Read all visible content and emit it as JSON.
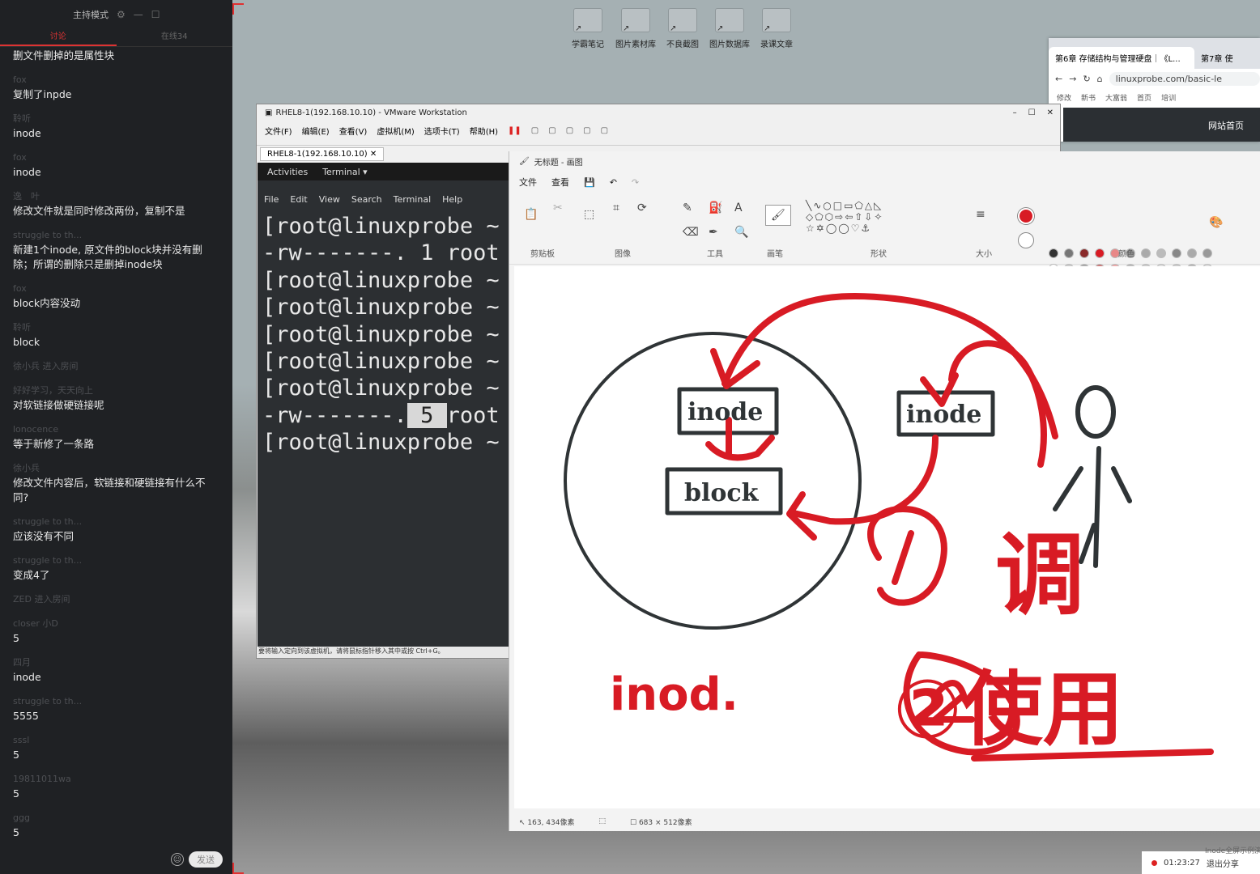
{
  "chat": {
    "mode_label": "主持模式",
    "tabs": [
      "讨论",
      "在线34"
    ],
    "messages": [
      {
        "user": "",
        "text": "删文件删掉的是属性块"
      },
      {
        "user": "fox",
        "text": "复制了inpde"
      },
      {
        "user": "聆听",
        "text": "inode"
      },
      {
        "user": "fox",
        "text": "inode"
      },
      {
        "user": "逸　叶",
        "text": "修改文件就是同时修改两份，复制不是"
      },
      {
        "user": "struggle to th...",
        "text": "新建1个inode, 原文件的block块并没有删除；所谓的删除只是删掉inode块"
      },
      {
        "user": "fox",
        "text": "block内容没动"
      },
      {
        "user": "聆听",
        "text": "block"
      },
      {
        "user": "徐小兵 进入房间",
        "text": ""
      },
      {
        "user": "好好学习，天天向上",
        "text": "对软链接做硬链接呢"
      },
      {
        "user": "lonocence",
        "text": "等于新修了一条路"
      },
      {
        "user": "徐小兵",
        "text": "修改文件内容后，软链接和硬链接有什么不同?"
      },
      {
        "user": "struggle to th...",
        "text": "应该没有不同"
      },
      {
        "user": "struggle to th...",
        "text": "变成4了"
      },
      {
        "user": "ZED 进入房间",
        "text": ""
      },
      {
        "user": "closer 小D",
        "text": "5"
      },
      {
        "user": "四月",
        "text": "inode"
      },
      {
        "user": "struggle to th...",
        "text": "5555"
      },
      {
        "user": "sssl",
        "text": "5"
      },
      {
        "user": "19811011wa",
        "text": "5"
      },
      {
        "user": "ggg",
        "text": "5"
      }
    ],
    "send_label": "发送"
  },
  "desktop": {
    "icons": [
      "学霸笔记",
      "图片素材库",
      "不良截图",
      "图片数据库",
      "录课文章"
    ]
  },
  "browser": {
    "tab1": "第6章 存储结构与管理硬盘｜《L...",
    "tab2": "第7章 使",
    "url": "linuxprobe.com/basic-le",
    "bookmarks": [
      "修改",
      "新书",
      "大富翁",
      "首页",
      "培训"
    ],
    "banner": "网站首页"
  },
  "vmware": {
    "title": "RHEL8-1(192.168.10.10) - VMware Workstation",
    "menus": [
      "文件(F)",
      "编辑(E)",
      "查看(V)",
      "虚拟机(M)",
      "选项卡(T)",
      "帮助(H)"
    ],
    "tab": "RHEL8-1(192.168.10.10)",
    "gnome": {
      "activities": "Activities",
      "terminal": "Terminal ▾"
    },
    "term_menu": [
      "File",
      "Edit",
      "View",
      "Search",
      "Terminal",
      "Help"
    ],
    "lines": [
      "[root@linuxprobe ~",
      "-rw-------. 1 root",
      "[root@linuxprobe ~",
      "[root@linuxprobe ~",
      "[root@linuxprobe ~",
      "[root@linuxprobe ~",
      "[root@linuxprobe ~",
      "-rw-------.",
      "[root@linuxprobe ~"
    ],
    "hl_count": " 5 ",
    "hl_suffix": "root",
    "status": "要将输入定向到该虚拟机，请将鼠标指针移入其中或按 Ctrl+G。"
  },
  "paint": {
    "title": "无标题 - 画图",
    "menus": [
      "文件",
      "查看"
    ],
    "groups": [
      "剪贴板",
      "图像",
      "工具",
      "画笔",
      "形状",
      "大小",
      "颜色"
    ],
    "status_pos": "163, 434像素",
    "status_size": "683 × 512像素",
    "canvas_text": {
      "inode_left": "inode",
      "block": "block",
      "inode_right": "inode",
      "hand_inode": "inod.",
      "hand_call": "调",
      "hand_use": "②使用"
    },
    "colors": {
      "ink": "#d81b24",
      "box": "#2f3436"
    }
  },
  "tray": {
    "time": "01:23:27",
    "share": "退出分享",
    "hint": "Inode全屏示例演"
  }
}
